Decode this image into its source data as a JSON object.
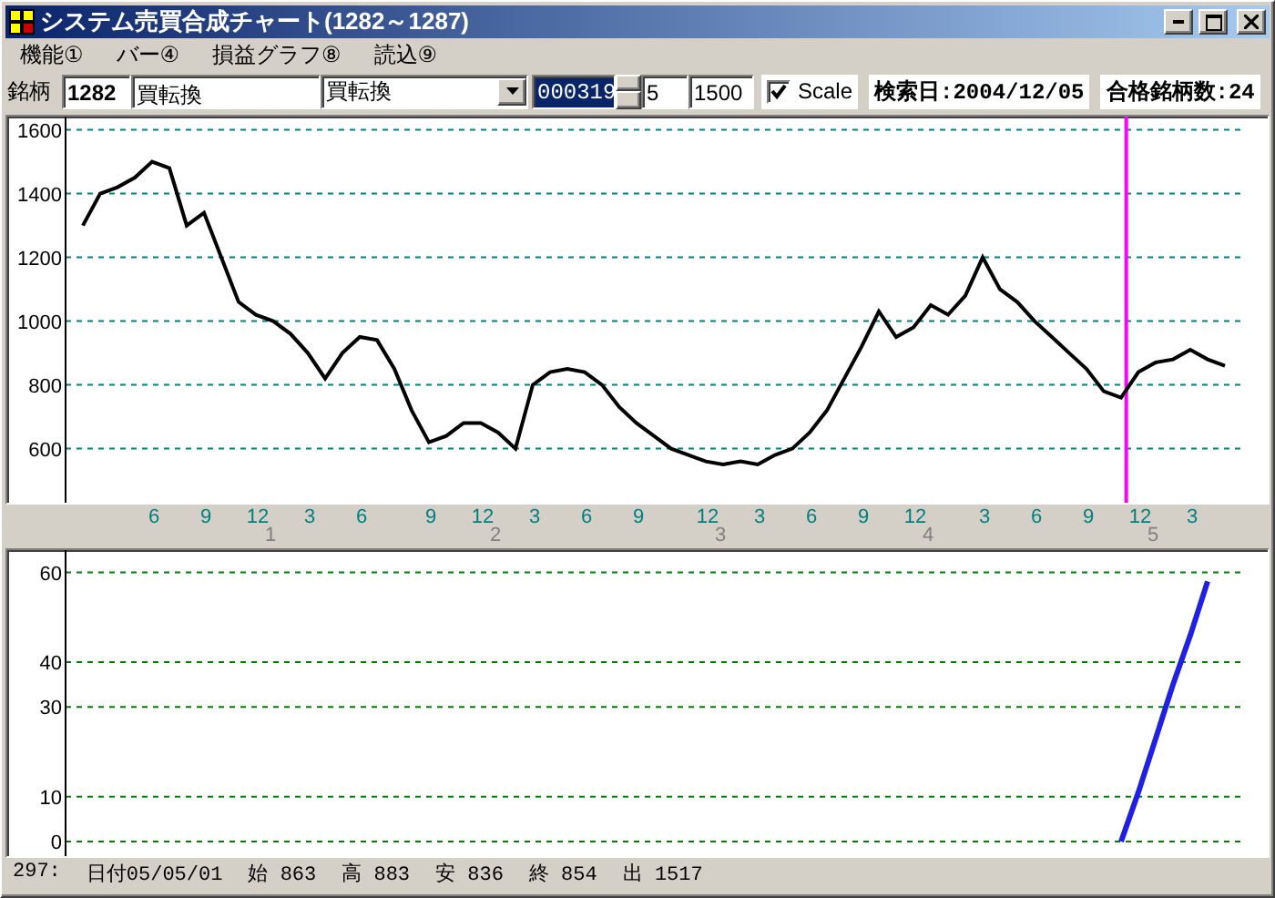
{
  "window": {
    "title": "システム売買合成チャート(1282～1287)"
  },
  "menu": [
    "機能①",
    "バー④",
    "損益グラフ⑧",
    "読込⑨"
  ],
  "toolbar": {
    "label": "銘柄",
    "code": "1282",
    "name": "買転換",
    "combo": "買転換",
    "counter": {
      "value": "000319",
      "highlighted": true
    },
    "field_1": "5",
    "field_2": "1500",
    "scale": {
      "label": "Scale",
      "checked": true
    },
    "search_date": "検索日:2004/12/05",
    "match_count": "合格銘柄数:24"
  },
  "price_chart": {
    "chart_data": {
      "type": "line",
      "ylim": [
        430,
        1630
      ],
      "yticks": [
        600,
        800,
        1000,
        1200,
        1400,
        1600
      ],
      "categories": [
        null,
        null,
        null,
        null,
        "6",
        null,
        null,
        "9",
        null,
        null,
        "12",
        null,
        null,
        "3",
        null,
        null,
        "6",
        null,
        null,
        null,
        "9",
        null,
        null,
        "12",
        null,
        null,
        "3",
        null,
        null,
        "6",
        null,
        null,
        "9",
        null,
        null,
        null,
        "12",
        null,
        null,
        "3",
        null,
        null,
        "6",
        null,
        null,
        "9",
        null,
        null,
        "12",
        null,
        null,
        null,
        "3",
        null,
        null,
        "6",
        null,
        null,
        "9",
        null,
        null,
        "12",
        null,
        null,
        "3",
        null,
        null
      ],
      "series": [
        {
          "color": "#000000",
          "values": [
            1300,
            1400,
            1420,
            1450,
            1500,
            1480,
            1300,
            1340,
            1200,
            1060,
            1020,
            1000,
            960,
            900,
            820,
            900,
            950,
            940,
            850,
            720,
            620,
            640,
            680,
            680,
            650,
            600,
            800,
            840,
            850,
            840,
            800,
            730,
            680,
            640,
            600,
            580,
            560,
            550,
            560,
            550,
            580,
            600,
            650,
            720,
            820,
            920,
            1030,
            950,
            980,
            1050,
            1020,
            1080,
            1200,
            1100,
            1060,
            1000,
            950,
            900,
            850,
            780,
            760,
            840,
            870,
            880,
            910,
            880,
            860
          ]
        }
      ],
      "grid": true
    },
    "year_labels": [
      "1",
      "2",
      "3",
      "4",
      "5"
    ]
  },
  "pnl_chart": {
    "chart_data": {
      "type": "line",
      "grid": true,
      "ylim": [
        0,
        65
      ],
      "yticks": [
        0,
        10,
        30,
        40,
        60
      ],
      "series": [
        {
          "color": "#2020e0",
          "values": [
            null,
            null,
            null,
            null,
            null,
            null,
            null,
            null,
            null,
            null,
            null,
            null,
            null,
            null,
            null,
            null,
            null,
            null,
            null,
            null,
            null,
            null,
            null,
            null,
            null,
            null,
            null,
            null,
            null,
            null,
            null,
            null,
            null,
            null,
            null,
            null,
            null,
            null,
            null,
            null,
            null,
            null,
            null,
            null,
            null,
            null,
            null,
            null,
            null,
            null,
            null,
            null,
            null,
            null,
            null,
            null,
            null,
            null,
            null,
            null,
            0,
            11,
            23,
            35,
            46,
            58,
            null
          ]
        }
      ]
    }
  },
  "status_bar": [
    "297:",
    "日付05/05/01",
    "始 863",
    "高 883",
    "安 836",
    "終 854",
    "出 1517"
  ]
}
